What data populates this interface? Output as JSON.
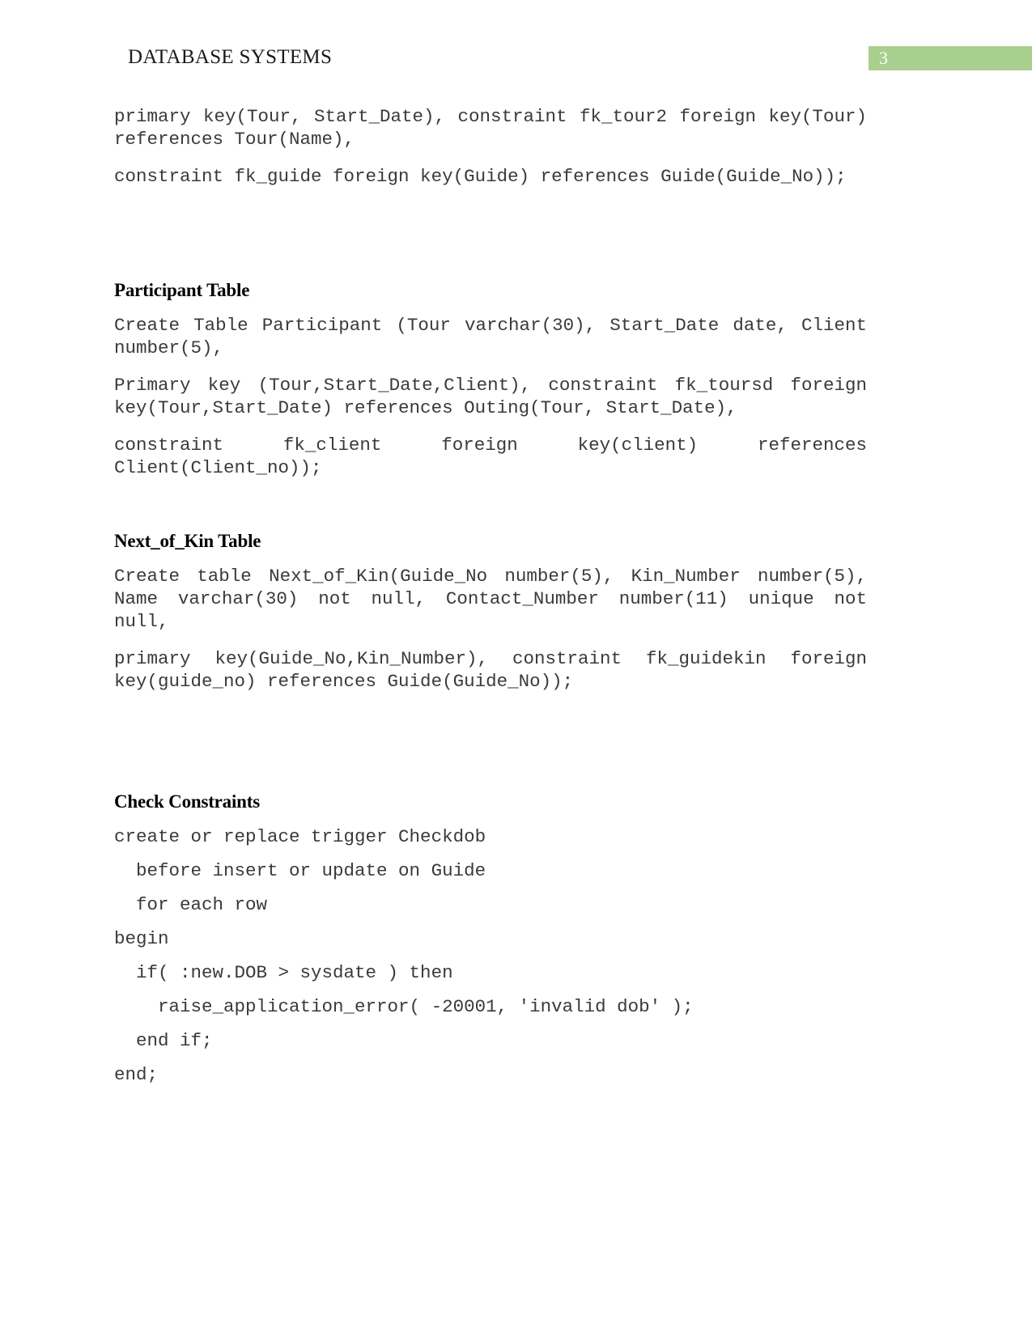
{
  "document": {
    "header_title": "DATABASE SYSTEMS",
    "page_number": "3",
    "accent_color": "#a9cf8e"
  },
  "sections": {
    "outing_continuation": {
      "paragraphs": [
        "primary key(Tour, Start_Date), constraint fk_tour2 foreign key(Tour) references Tour(Name),",
        "constraint fk_guide foreign key(Guide) references Guide(Guide_No));"
      ]
    },
    "participant": {
      "heading": "Participant Table",
      "paragraphs": [
        "Create Table Participant (Tour varchar(30), Start_Date date, Client number(5),",
        "Primary key (Tour,Start_Date,Client), constraint fk_toursd foreign key(Tour,Start_Date) references Outing(Tour, Start_Date),",
        "constraint fk_client foreign key(client) references Client(Client_no));"
      ]
    },
    "next_of_kin": {
      "heading": "Next_of_Kin Table",
      "paragraphs": [
        "Create table Next_of_Kin(Guide_No number(5), Kin_Number number(5), Name varchar(30) not null, Contact_Number number(11) unique not null,",
        "primary key(Guide_No,Kin_Number), constraint fk_guidekin foreign key(guide_no) references Guide(Guide_No));"
      ]
    },
    "check_constraints": {
      "heading": "Check Constraints",
      "trigger_lines": [
        "create or replace trigger Checkdob",
        "  before insert or update on Guide",
        "  for each row",
        "begin",
        "  if( :new.DOB > sysdate ) then",
        "    raise_application_error( -20001, 'invalid dob' );",
        "  end if;",
        "end;"
      ]
    }
  }
}
